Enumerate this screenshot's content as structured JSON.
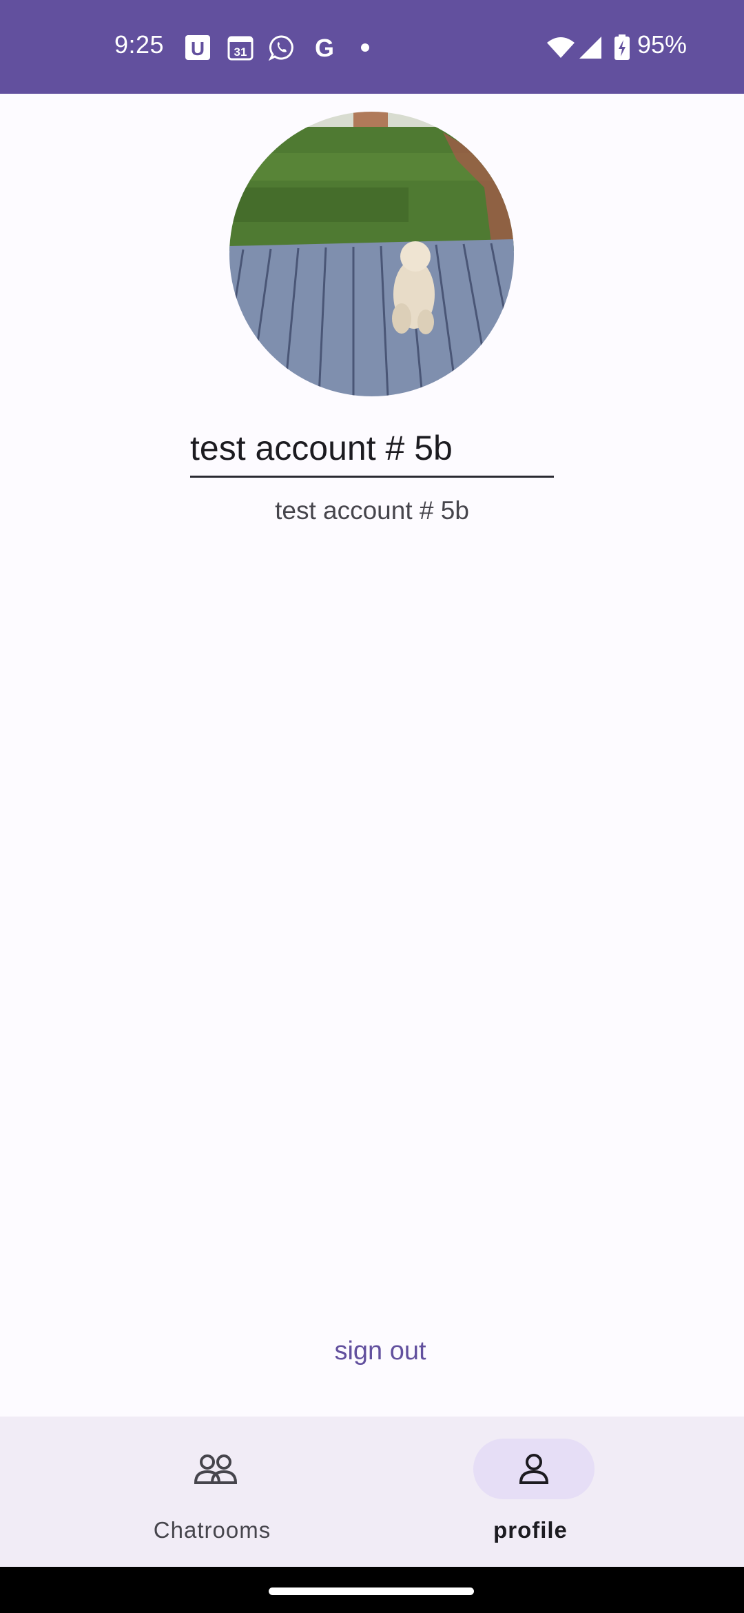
{
  "status_bar": {
    "time": "9:25",
    "battery": "95%",
    "notification_icons": [
      "u-app-icon",
      "calendar-31-icon",
      "whatsapp-icon",
      "grammarly-icon",
      "dot-icon"
    ],
    "calendar_day": "31",
    "u_letter": "U",
    "g_letter": "G"
  },
  "profile": {
    "name_value": "test account # 5b",
    "display_name": "test account # 5b",
    "avatar": "dog-on-deck-photo"
  },
  "actions": {
    "sign_out": "sign out"
  },
  "bottom_nav": {
    "items": [
      {
        "label": "Chatrooms",
        "icon": "people-icon",
        "selected": false
      },
      {
        "label": "profile",
        "icon": "person-icon",
        "selected": true
      }
    ]
  },
  "colors": {
    "primary": "#62509e",
    "nav_bg": "#f1ecf6",
    "nav_active_pill": "#e6def6",
    "background": "#fdfbff"
  }
}
